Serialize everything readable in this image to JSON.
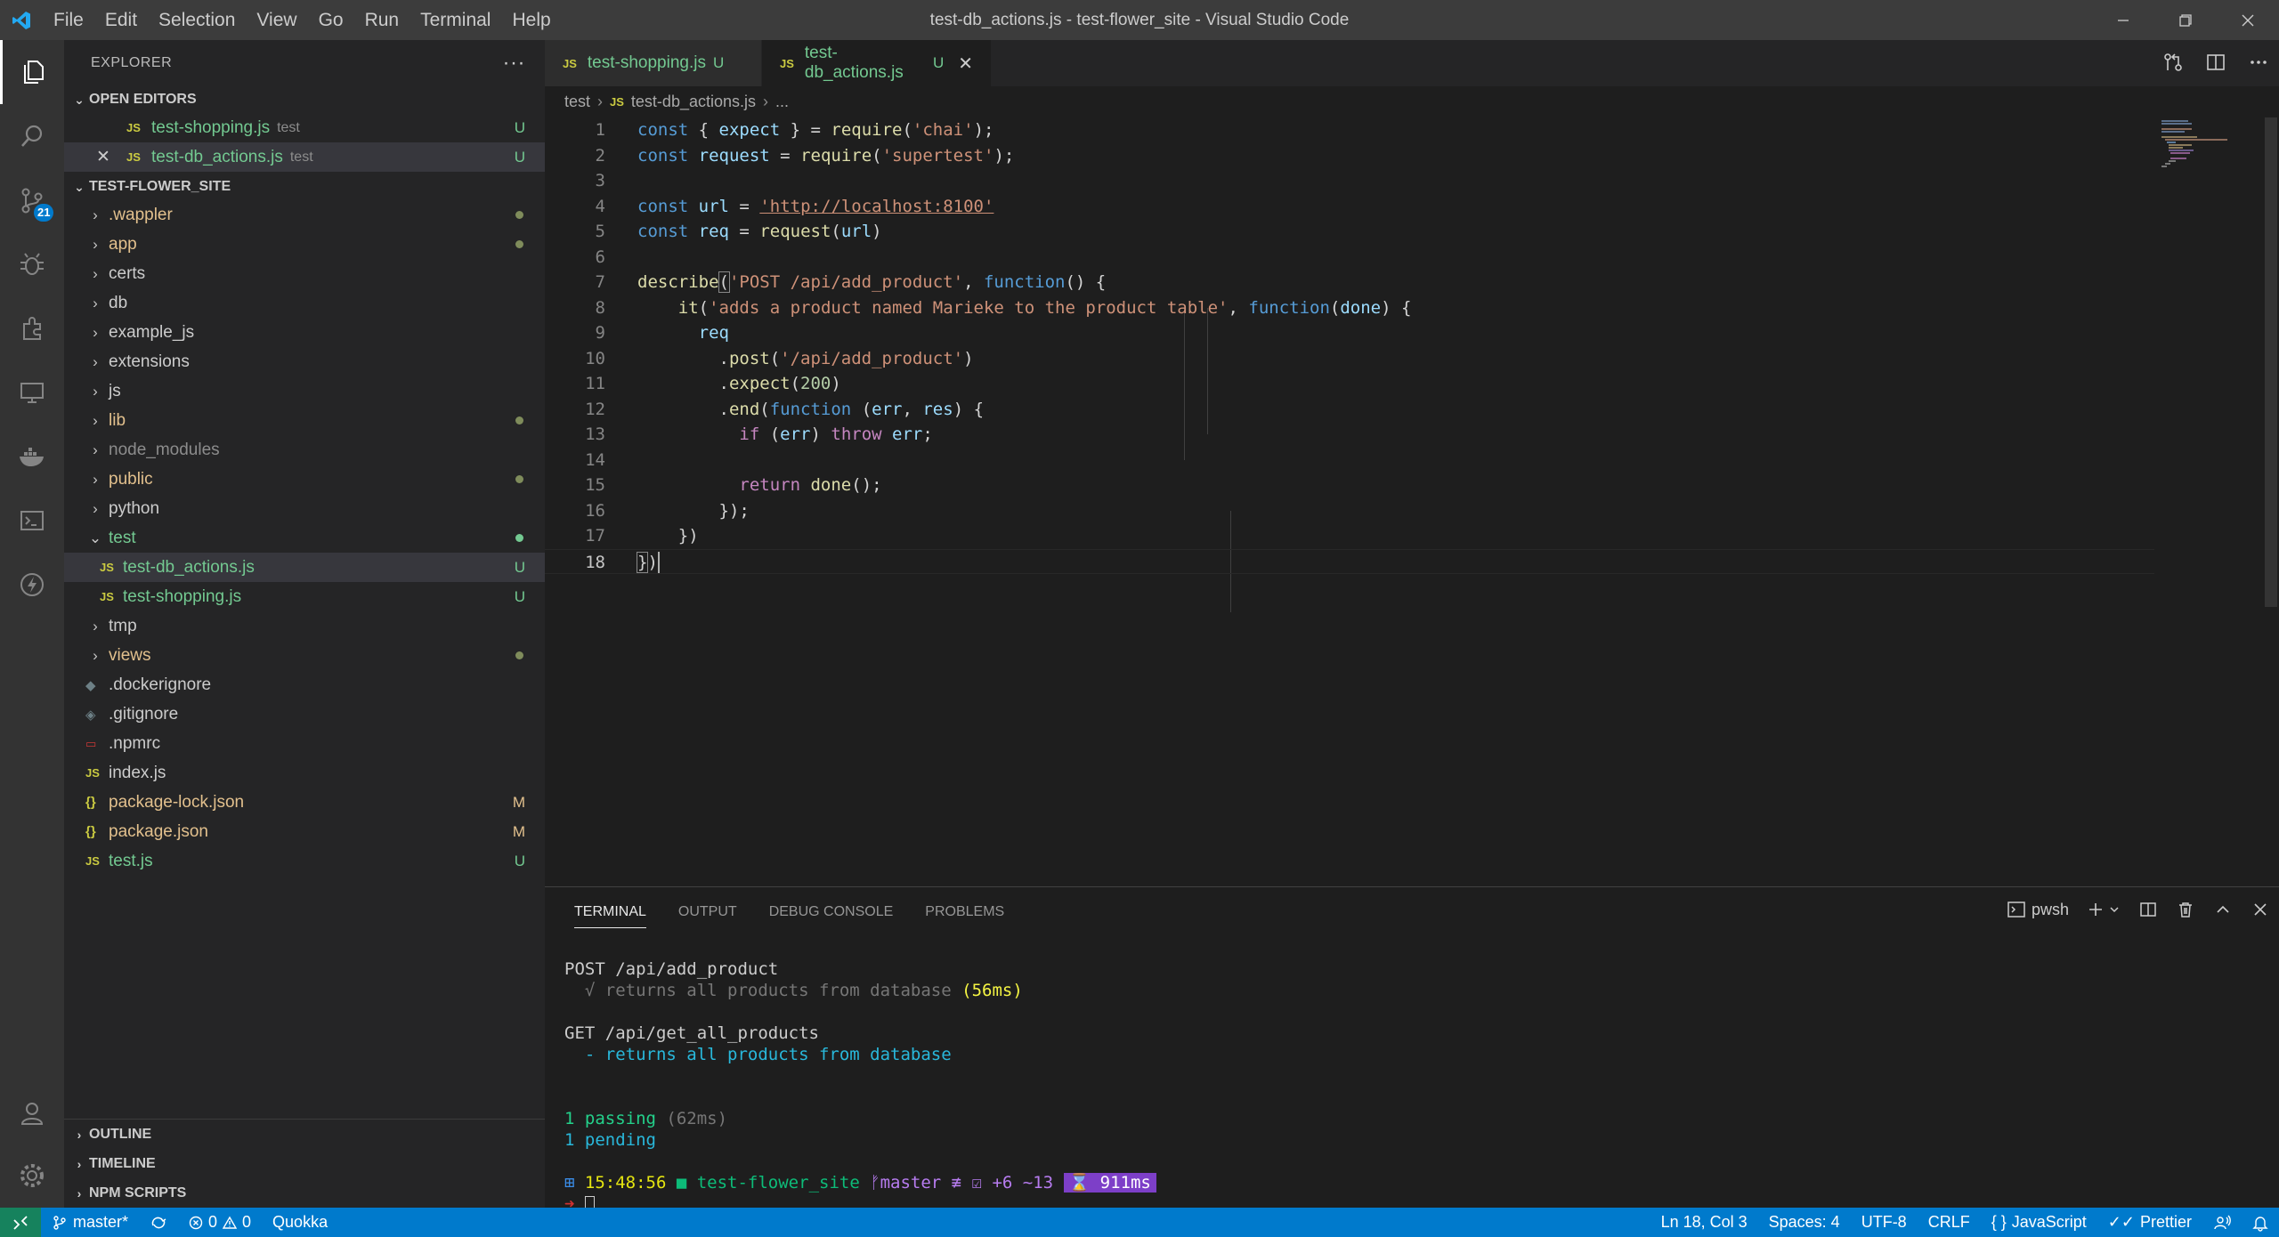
{
  "window": {
    "title": "test-db_actions.js - test-flower_site - Visual Studio Code",
    "menu": [
      "File",
      "Edit",
      "Selection",
      "View",
      "Go",
      "Run",
      "Terminal",
      "Help"
    ]
  },
  "activity": {
    "scm_badge": "21"
  },
  "sidebar": {
    "title": "EXPLORER",
    "open_editors_title": "OPEN EDITORS",
    "open_editors": [
      {
        "name": "test-shopping.js",
        "folder": "test",
        "status": "U"
      },
      {
        "name": "test-db_actions.js",
        "folder": "test",
        "status": "U"
      }
    ],
    "project_title": "TEST-FLOWER_SITE",
    "tree": [
      {
        "name": ".wappler"
      },
      {
        "name": "app"
      },
      {
        "name": "certs"
      },
      {
        "name": "db"
      },
      {
        "name": "example_js"
      },
      {
        "name": "extensions"
      },
      {
        "name": "js"
      },
      {
        "name": "lib"
      },
      {
        "name": "node_modules"
      },
      {
        "name": "public"
      },
      {
        "name": "python"
      },
      {
        "name": "test"
      },
      {
        "name": "test-db_actions.js",
        "status": "U"
      },
      {
        "name": "test-shopping.js",
        "status": "U"
      },
      {
        "name": "tmp"
      },
      {
        "name": "views"
      },
      {
        "name": ".dockerignore"
      },
      {
        "name": ".gitignore"
      },
      {
        "name": ".npmrc"
      },
      {
        "name": "index.js"
      },
      {
        "name": "package-lock.json",
        "status": "M"
      },
      {
        "name": "package.json",
        "status": "M"
      },
      {
        "name": "test.js",
        "status": "U"
      }
    ],
    "outline": "OUTLINE",
    "timeline": "TIMELINE",
    "npm_scripts": "NPM SCRIPTS"
  },
  "tabs": [
    {
      "label": "test-shopping.js",
      "flag": "U"
    },
    {
      "label": "test-db_actions.js",
      "flag": "U"
    }
  ],
  "breadcrumb": {
    "folder": "test",
    "file": "test-db_actions.js",
    "more": "..."
  },
  "editor": {
    "line_numbers": [
      "1",
      "2",
      "3",
      "4",
      "5",
      "6",
      "7",
      "8",
      "9",
      "10",
      "11",
      "12",
      "13",
      "14",
      "15",
      "16",
      "17",
      "18"
    ],
    "code": {
      "require_fn": "require",
      "chai": "'chai'",
      "supertest": "'supertest'",
      "url": "'http://localhost:8100'",
      "describe_title": "'POST /api/add_product'",
      "it_title": "'adds a product named Marieke to the product table'",
      "post_path": "'/api/add_product'",
      "status_code": "200"
    }
  },
  "panel": {
    "tabs": [
      "TERMINAL",
      "OUTPUT",
      "DEBUG CONSOLE",
      "PROBLEMS"
    ],
    "shell": "pwsh",
    "terminal": {
      "suite1": "POST /api/add_product",
      "test1": "  √ returns all products from database",
      "test1_time": " (56ms)",
      "suite2": "GET /api/get_all_products",
      "test2": "  - returns all products from database",
      "passing": "1 passing",
      "passing_time": " (62ms)",
      "pending": "1 pending",
      "prompt_time": "15:48:56",
      "prompt_dir": "test-flower_site",
      "prompt_git": "master ≢ ☑ +6 ~13",
      "prompt_duration": "911ms"
    }
  },
  "statusbar": {
    "branch": "master*",
    "errors": "0",
    "warnings": "0",
    "quokka": "Quokka",
    "position": "Ln 18, Col 3",
    "spaces": "Spaces: 4",
    "encoding": "UTF-8",
    "eol": "CRLF",
    "language": "JavaScript",
    "prettier": "Prettier"
  }
}
